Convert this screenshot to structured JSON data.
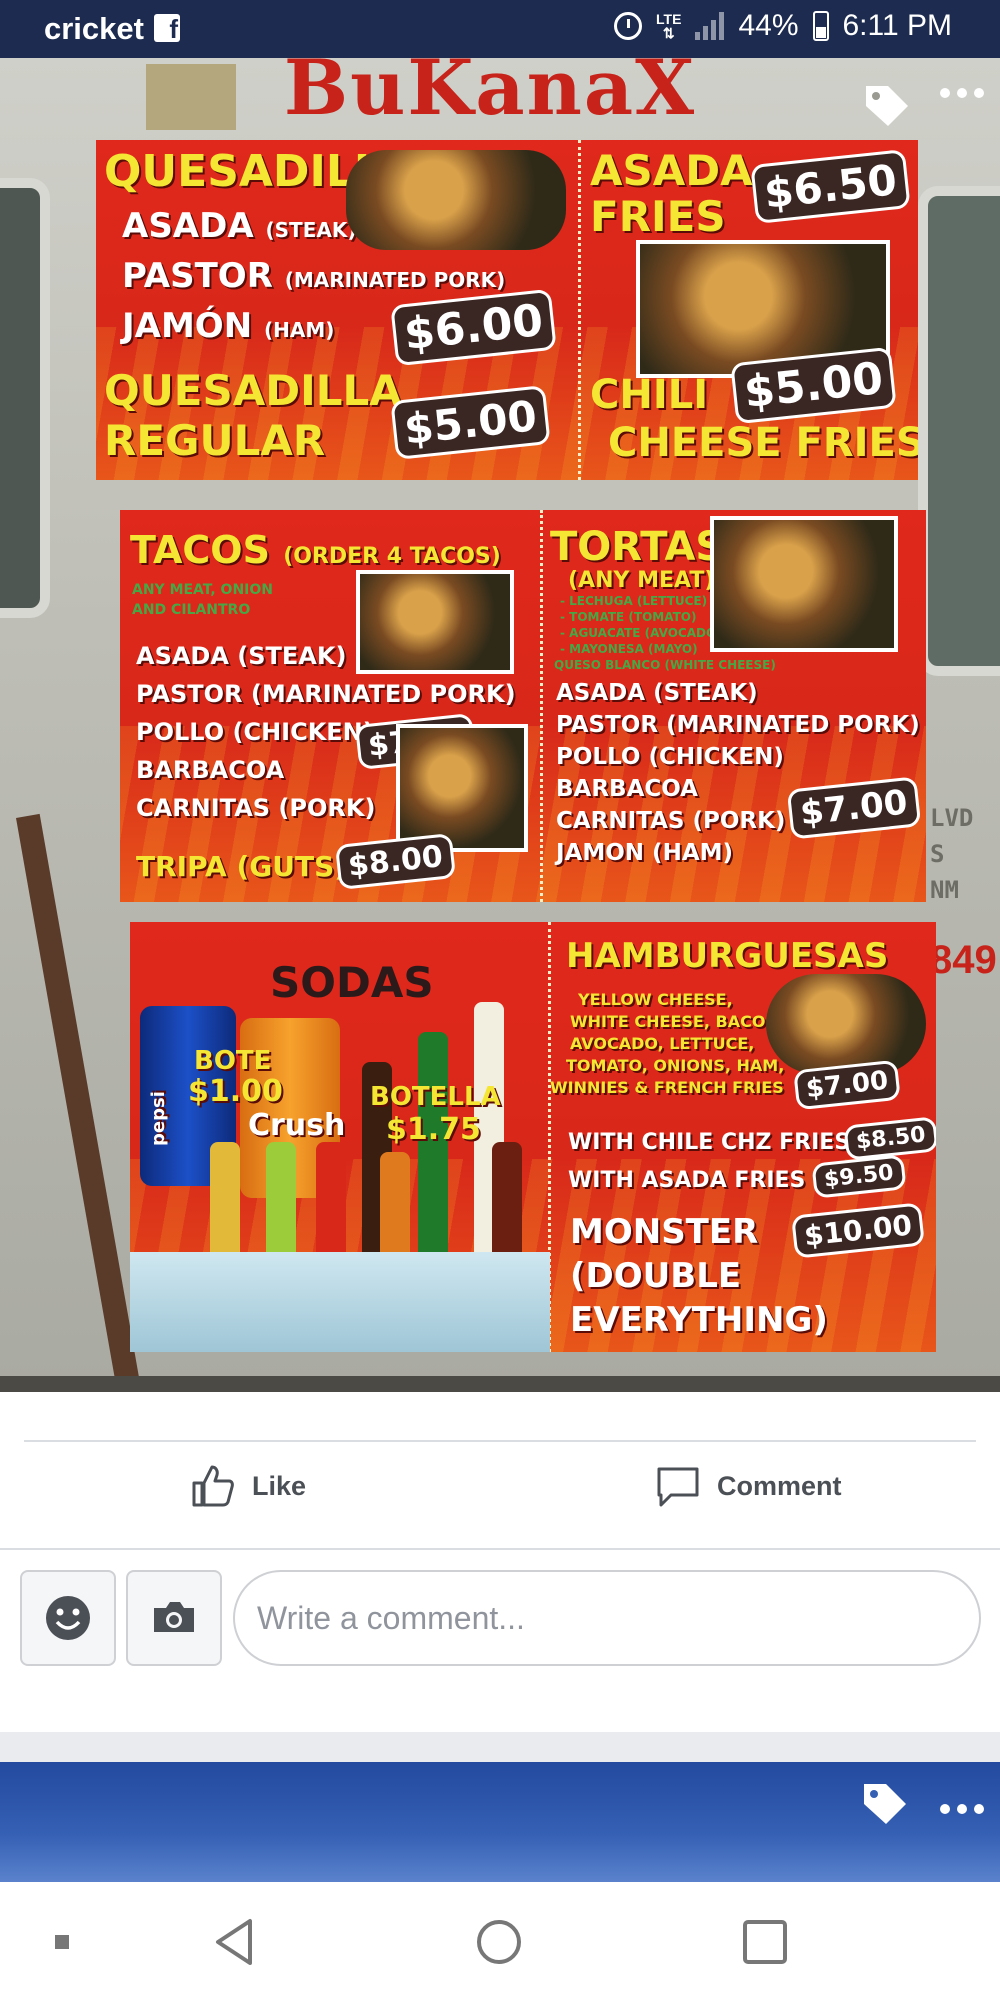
{
  "status_bar": {
    "carrier": "cricket",
    "battery": "44%",
    "time": "6:11 PM",
    "network": "LTE"
  },
  "photo": {
    "logo": "BuKanaX",
    "side_text_1": "LVD S",
    "side_text_2": "NM",
    "side_num": "849",
    "menu": {
      "quesadilla_title": "QUESADILLA",
      "quesadilla_items": [
        {
          "name": "ASADA",
          "note": "(STEAK)"
        },
        {
          "name": "PASTOR",
          "note": "(MARINATED PORK)"
        },
        {
          "name": "JAMÓN",
          "note": "(HAM)"
        }
      ],
      "quesadilla_price": "$6.00",
      "quesadilla_regular_line1": "QUESADILLA",
      "quesadilla_regular_line2": "REGULAR",
      "quesadilla_regular_price": "$5.00",
      "asada_fries_line1": "ASADA",
      "asada_fries_line2": "FRIES",
      "asada_fries_price": "$6.50",
      "chili_fries_line1": "CHILI",
      "chili_fries_line2": "CHEESE FRIES",
      "chili_fries_price": "$5.00",
      "tacos_title": "TACOS",
      "tacos_note": "(ORDER 4 TACOS)",
      "tacos_sub1": "ANY MEAT, ONION",
      "tacos_sub2": "AND CILANTRO",
      "tacos_items": [
        "ASADA (STEAK)",
        "PASTOR (MARINATED PORK)",
        "POLLO (CHICKEN)",
        "BARBACOA",
        "CARNITAS (PORK)"
      ],
      "tacos_price": "$7.00",
      "tripa": "TRIPA (GUTS)",
      "tripa_price": "$8.00",
      "tortas_title": "TORTAS",
      "tortas_note": "(ANY MEAT)",
      "tortas_toppings": [
        "- LECHUGA (LETTUCE)",
        "- TOMATE (TOMATO)",
        "- AGUACATE (AVOCADO)",
        "- MAYONESA (MAYO)",
        "QUESO BLANCO (WHITE CHEESE)"
      ],
      "tortas_items": [
        "ASADA (STEAK)",
        "PASTOR (MARINATED PORK)",
        "POLLO (CHICKEN)",
        "BARBACOA",
        "CARNITAS (PORK)",
        "JAMON (HAM)"
      ],
      "tortas_price": "$7.00",
      "sodas_title": "SODAS",
      "bote": "BOTE",
      "bote_price": "$1.00",
      "botella": "BOTELLA",
      "botella_price": "$1.75",
      "can_brand_1": "pepsi",
      "can_brand_2": "Crush",
      "hamburguesas_title": "HAMBURGUESAS",
      "hamburguesas_desc": [
        "YELLOW CHEESE,",
        "WHITE CHEESE, BACON,",
        "AVOCADO, LETTUCE,",
        "TOMATO, ONIONS, HAM,",
        "WINNIES & FRENCH FRIES"
      ],
      "hamburguesas_price": "$7.00",
      "with_chile_fries": "WITH CHILE CHZ FRIES",
      "with_chile_fries_price": "$8.50",
      "with_asada_fries": "WITH ASADA FRIES",
      "with_asada_fries_price": "$9.50",
      "monster_line1": "MONSTER",
      "monster_line2": "(DOUBLE",
      "monster_line3": "EVERYTHING)",
      "monster_price": "$10.00"
    }
  },
  "actions": {
    "like_label": "Like",
    "comment_label": "Comment"
  },
  "comment_box": {
    "placeholder": "Write a comment..."
  },
  "icons": {
    "photo_tag": "tag-icon",
    "more": "more-icon",
    "emoji": "emoji-icon",
    "camera": "camera-icon"
  },
  "colors": {
    "status_bar": "#1c2b4f",
    "menu_red": "#d8281a",
    "menu_yellow": "#f5e634",
    "fb_blue": "#3560b4"
  }
}
